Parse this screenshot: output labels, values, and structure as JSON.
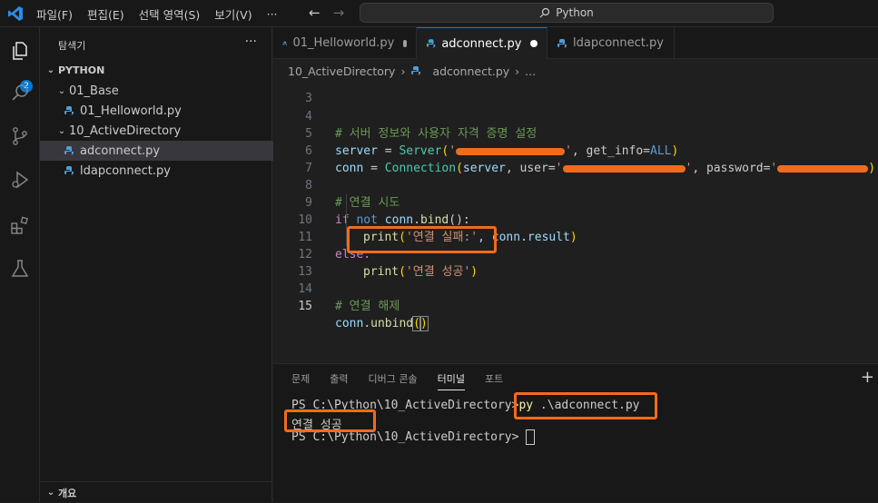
{
  "menu": [
    "파일(F)",
    "편집(E)",
    "선택 영역(S)",
    "보기(V)",
    "···"
  ],
  "nav": {
    "back": "←",
    "forward": "→"
  },
  "command_center": {
    "label": "Python"
  },
  "activity": {
    "badge": "2"
  },
  "sidebar": {
    "title": "탐색기",
    "more": "···",
    "root": "PYTHON",
    "items": [
      {
        "label": "01_Base"
      },
      {
        "label": "01_Helloworld.py"
      },
      {
        "label": "10_ActiveDirectory"
      },
      {
        "label": "adconnect.py"
      },
      {
        "label": "ldapconnect.py"
      }
    ],
    "outline": "개요"
  },
  "tabs": [
    {
      "label": "01_Helloworld.py"
    },
    {
      "label": "adconnect.py"
    },
    {
      "label": "ldapconnect.py"
    }
  ],
  "breadcrumb": {
    "folder": "10_ActiveDirectory",
    "file": "adconnect.py",
    "more": "..."
  },
  "editor": {
    "line_numbers": [
      "3",
      "4",
      "5",
      "6",
      "7",
      "8",
      "9",
      "10",
      "11",
      "12",
      "13",
      "14",
      "15"
    ],
    "line4": "# 서버 정보와 사용자 자격 증명 설정",
    "line5": {
      "var": "server",
      "eq": " = ",
      "cls": "Server",
      "open": "(",
      "str_open": "'",
      "str_close": "'",
      "rest1": ", get_info=",
      "const": "ALL",
      "close": ")"
    },
    "line6": {
      "var": "conn",
      "eq": " = ",
      "cls": "Connection",
      "open": "(",
      "arg": "server",
      "kw1": ", user=",
      "q1": "'",
      "q2": "'",
      "kw2": ", password=",
      "q3": "'",
      "close": ")"
    },
    "line8": "# 연결 시도",
    "line9": {
      "kw": "if",
      "not": " not ",
      "obj": "conn",
      "dot": ".",
      "fn": "bind",
      "tail": "():"
    },
    "line10": {
      "fn": "print",
      "open": "(",
      "str": "'연결 실패:'",
      "mid": ", conn.result",
      "close": ")"
    },
    "line11": "else:",
    "line12": {
      "fn": "print",
      "open": "(",
      "str": "'연결 성공'",
      "close": ")"
    },
    "line14": "# 연결 해제",
    "line15": {
      "obj": "conn",
      "dot": ".",
      "fn": "unbind",
      "open": "(",
      "close": ")"
    }
  },
  "panel": {
    "tabs": [
      "문제",
      "출력",
      "디버그 콘솔",
      "터미널",
      "포트"
    ],
    "add": "+",
    "prompt1": "PS C:\\Python\\10_ActiveDirectory>",
    "cmd_py": "py",
    "cmd_arg": " .\\adconnect.py",
    "output": "연결 성공",
    "prompt2": "PS C:\\Python\\10_ActiveDirectory>"
  },
  "colors": {
    "accent": "#0078d4",
    "highlight": "#f26b1d"
  }
}
